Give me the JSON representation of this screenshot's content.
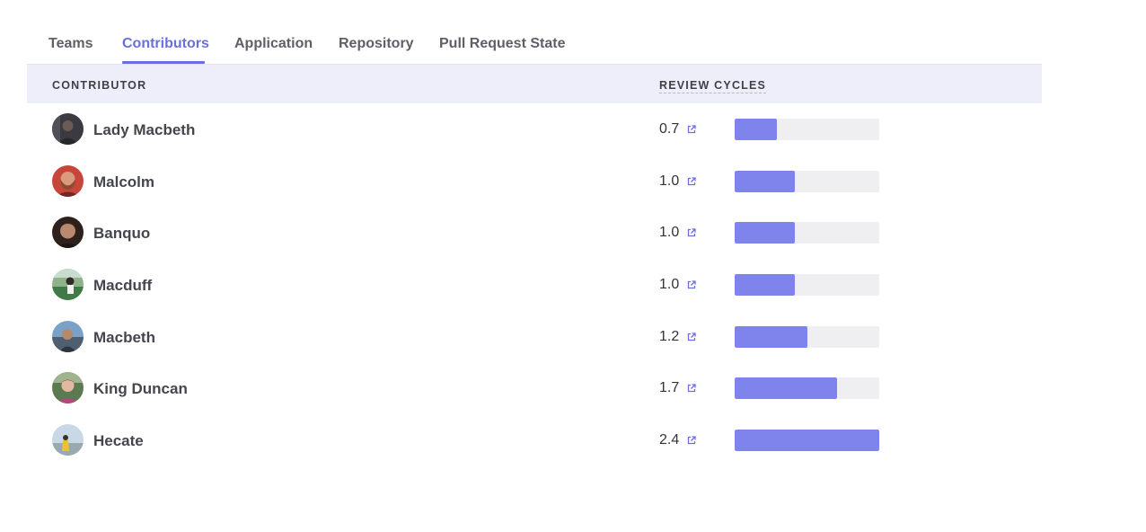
{
  "tabs": [
    {
      "label": "Teams",
      "active": false
    },
    {
      "label": "Contributors",
      "active": true
    },
    {
      "label": "Application",
      "active": false
    },
    {
      "label": "Repository",
      "active": false
    },
    {
      "label": "Pull Request State",
      "active": false
    }
  ],
  "table": {
    "col_contributor": "CONTRIBUTOR",
    "col_review_cycles": "REVIEW CYCLES",
    "max_value": 2.4,
    "rows": [
      {
        "name": "Lady Macbeth",
        "value": "0.7",
        "avatar_icon": "avatar-photo-dark"
      },
      {
        "name": "Malcolm",
        "value": "1.0",
        "avatar_icon": "avatar-photo-red"
      },
      {
        "name": "Banquo",
        "value": "1.0",
        "avatar_icon": "avatar-photo-brown"
      },
      {
        "name": "Macduff",
        "value": "1.0",
        "avatar_icon": "avatar-photo-green"
      },
      {
        "name": "Macbeth",
        "value": "1.2",
        "avatar_icon": "avatar-photo-blue"
      },
      {
        "name": "King Duncan",
        "value": "1.7",
        "avatar_icon": "avatar-photo-garden"
      },
      {
        "name": "Hecate",
        "value": "2.4",
        "avatar_icon": "avatar-photo-sky"
      }
    ]
  },
  "colors": {
    "accent": "#6a6fe0",
    "bar_fill": "#7f83ec",
    "bar_track": "#efeff1",
    "header_bg": "#eeeefb"
  }
}
